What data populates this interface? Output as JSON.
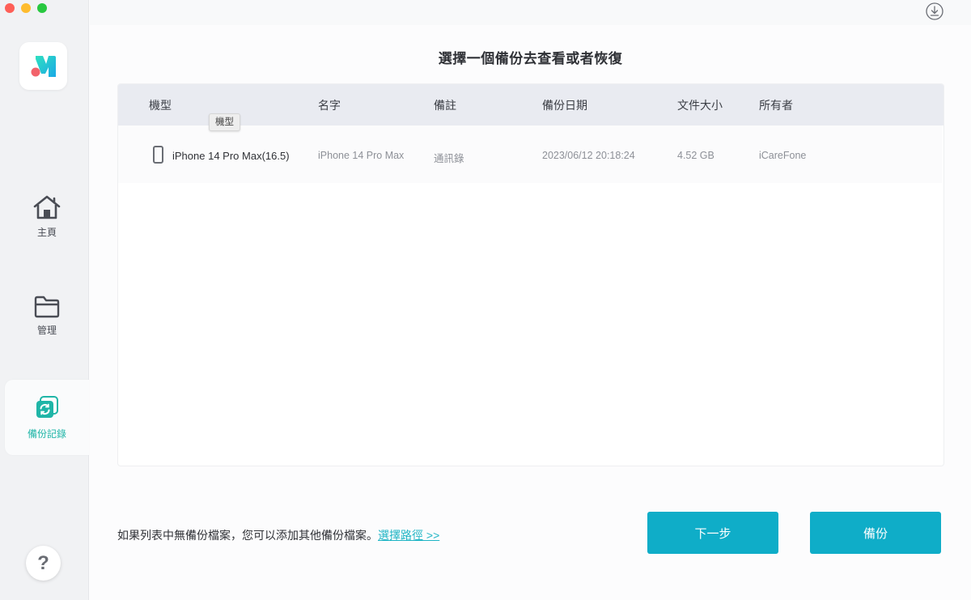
{
  "window": {
    "controls": [
      "close",
      "minimize",
      "maximize"
    ]
  },
  "sidebar": {
    "logo": "app-logo",
    "items": [
      {
        "label": "主頁",
        "icon": "home-icon",
        "active": false
      },
      {
        "label": "管理",
        "icon": "folder-icon",
        "active": false
      },
      {
        "label": "備份記錄",
        "icon": "backup-history-icon",
        "active": true
      }
    ],
    "help_label": "?"
  },
  "topbar": {
    "download_icon": "download-icon"
  },
  "main": {
    "title": "選擇一個備份去查看或者恢復",
    "table": {
      "columns": [
        "機型",
        "名字",
        "備註",
        "備份日期",
        "文件大小",
        "所有者"
      ],
      "tooltip": "機型",
      "rows": [
        {
          "model": "iPhone 14 Pro Max(16.5)",
          "name": "iPhone 14 Pro Max",
          "note": "通訊錄",
          "date": "2023/06/12 20:18:24",
          "size": "4.52 GB",
          "owner": "iCareFone"
        }
      ]
    },
    "footer": {
      "hint": "如果列表中無備份檔案，您可以添加其他備份檔案。",
      "link": "選擇路徑 >>"
    },
    "buttons": {
      "next": "下一步",
      "backup": "備份"
    }
  },
  "colors": {
    "accent": "#0fadc8",
    "active_nav": "#1fb5a7",
    "link": "#1fb5c5"
  }
}
